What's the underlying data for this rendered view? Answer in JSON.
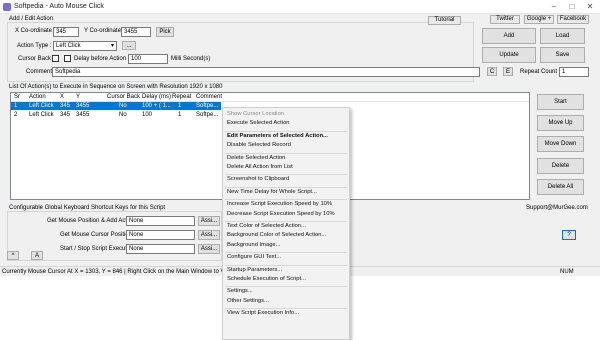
{
  "window": {
    "title": "Softpedia - Auto Mouse Click",
    "min": "–",
    "max": "□",
    "close": "✕"
  },
  "add_edit": {
    "group_label": "Add / Edit Action",
    "tutorial": "Tutorial",
    "twitter": "Twitter",
    "google": "Google +",
    "facebook": "Facebook",
    "x_label": "X Co-ordinate :",
    "x_value": "345",
    "y_label": "Y Co-ordinate :",
    "y_value": "3455",
    "pick": "Pick",
    "action_type_label": "Action Type :",
    "action_type_value": "Left Click",
    "dots": "...",
    "cursor_back_label": "Cursor Back :",
    "delay_label": "Delay before Action :",
    "delay_value": "100",
    "delay_unit": "Milli Second(s)",
    "comment_label": "Comment :",
    "comment_value": "Softpedia",
    "c_btn": "C",
    "e_btn": "E",
    "repeat_label": "Repeat Count :",
    "repeat_value": "1"
  },
  "side_buttons": {
    "add": "Add",
    "load": "Load",
    "update": "Update",
    "save": "Save"
  },
  "list": {
    "title": "List Of Action(s) to Execute in Sequence on Screen with Resolution 1920 x 1080",
    "columns": [
      "Sr",
      "Action",
      "X",
      "Y",
      "Cursor Back",
      "Delay (ms)",
      "Repeat",
      "Comment"
    ],
    "rows": [
      [
        "1",
        "Left Click",
        "345",
        "3455",
        "No",
        "100 + ( 1...",
        "1",
        "Softpe..."
      ],
      [
        "2",
        "Left Click",
        "345",
        "3455",
        "No",
        "100",
        "1",
        "Softpe..."
      ]
    ]
  },
  "right_buttons": {
    "start": "Start",
    "move_up": "Move Up",
    "move_down": "Move Down",
    "delete": "Delete",
    "delete_all": "Delete All",
    "help": "?"
  },
  "shortcuts": {
    "title": "Configurable Global Keyboard Shortcut Keys for this Script",
    "support": "Support@MurGee.com",
    "rows": [
      {
        "label": "Get Mouse Position & Add Action :",
        "value": "None",
        "btn": "Assi..."
      },
      {
        "label": "Get Mouse Cursor Position :",
        "value": "None",
        "btn": "Assi..."
      },
      {
        "label": "Start / Stop Script Execution :",
        "value": "None",
        "btn": "Assi..."
      }
    ],
    "caret": "^",
    "a": "A"
  },
  "status": {
    "text": "Currently Mouse Cursor At X = 1303, Y = 846 | Right Click on the Main Window to Vi...",
    "num": "NUM"
  },
  "context_menu": {
    "items": [
      "Show Cursor Location",
      "Execute Selected Action",
      "---",
      "Edit Parameters of Selected Action...",
      "Disable Selected Record",
      "---",
      "Delete Selected Action",
      "Delete All Action from List",
      "---",
      "Screenshot to Clipboard",
      "---",
      "New Time Delay for Whole Script...",
      "---",
      "Increase Script Execution Speed by 10%",
      "Decrease Script Execution Speed by 10%",
      "---",
      "Text Color of Selected Action...",
      "Background Color of Selected Action...",
      "Background Image...",
      "---",
      "Configure GUI Text...",
      "---",
      "Startup Parameters...",
      "Schedule Execution of Script...",
      "---",
      "Settings...",
      "Other Settings...",
      "---",
      "View Script Execution Info..."
    ]
  },
  "colors": {
    "selection": "#0078d7",
    "accent_icon": "#7d6bd6"
  }
}
